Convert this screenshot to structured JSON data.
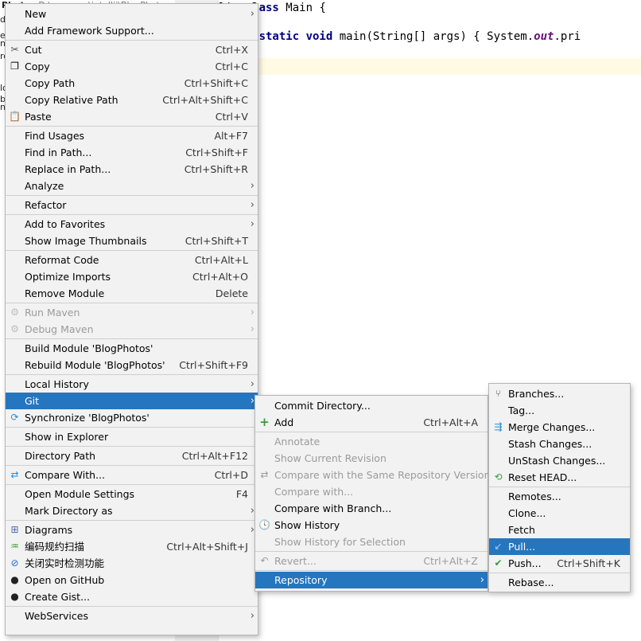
{
  "project_panel": {
    "title": "Photos",
    "path": "D:\\program\\intellij\\BlogPhotos",
    "tree_fragments": [
      "d",
      "e",
      "n",
      "ro",
      "",
      "lo",
      "b",
      "n"
    ]
  },
  "editor": {
    "line1_prefix": "lic ",
    "line1_kw": "class",
    "line1_rest": " Main {",
    "line2_kw": "ublic static void",
    "line2_rest": " main(String[] args) { System.",
    "line2_field": "out",
    "line2_tail": ".pri"
  },
  "context_menu": [
    {
      "label": "New",
      "arrow": true
    },
    {
      "label": "Add Framework Support..."
    },
    {
      "sep": true
    },
    {
      "label": "Cut",
      "shortcut": "Ctrl+X",
      "icon": "✂",
      "icon_name": "cut-icon"
    },
    {
      "label": "Copy",
      "shortcut": "Ctrl+C",
      "icon": "❐",
      "icon_name": "copy-icon"
    },
    {
      "label": "Copy Path",
      "shortcut": "Ctrl+Shift+C"
    },
    {
      "label": "Copy Relative Path",
      "shortcut": "Ctrl+Alt+Shift+C"
    },
    {
      "label": "Paste",
      "shortcut": "Ctrl+V",
      "icon": "📋",
      "icon_name": "paste-icon"
    },
    {
      "sep": true
    },
    {
      "label": "Find Usages",
      "shortcut": "Alt+F7"
    },
    {
      "label": "Find in Path...",
      "shortcut": "Ctrl+Shift+F"
    },
    {
      "label": "Replace in Path...",
      "shortcut": "Ctrl+Shift+R"
    },
    {
      "label": "Analyze",
      "arrow": true
    },
    {
      "sep": true
    },
    {
      "label": "Refactor",
      "arrow": true
    },
    {
      "sep": true
    },
    {
      "label": "Add to Favorites",
      "arrow": true
    },
    {
      "label": "Show Image Thumbnails",
      "shortcut": "Ctrl+Shift+T"
    },
    {
      "sep": true
    },
    {
      "label": "Reformat Code",
      "shortcut": "Ctrl+Alt+L"
    },
    {
      "label": "Optimize Imports",
      "shortcut": "Ctrl+Alt+O"
    },
    {
      "label": "Remove Module",
      "shortcut": "Delete"
    },
    {
      "sep": true
    },
    {
      "label": "Run Maven",
      "arrow": true,
      "disabled": true,
      "icon": "⚙",
      "icon_name": "maven-gear-icon"
    },
    {
      "label": "Debug Maven",
      "arrow": true,
      "disabled": true,
      "icon": "⚙",
      "icon_name": "maven-debug-icon"
    },
    {
      "sep": true
    },
    {
      "label": "Build Module 'BlogPhotos'"
    },
    {
      "label": "Rebuild Module 'BlogPhotos'",
      "shortcut": "Ctrl+Shift+F9"
    },
    {
      "sep": true
    },
    {
      "label": "Local History",
      "arrow": true
    },
    {
      "label": "Git",
      "arrow": true,
      "selected": true
    },
    {
      "label": "Synchronize 'BlogPhotos'",
      "icon": "⟳",
      "icon_name": "synchronize-icon"
    },
    {
      "sep": true
    },
    {
      "label": "Show in Explorer"
    },
    {
      "sep": true
    },
    {
      "label": "Directory Path",
      "shortcut": "Ctrl+Alt+F12"
    },
    {
      "sep": true
    },
    {
      "label": "Compare With...",
      "shortcut": "Ctrl+D",
      "icon": "⇄",
      "icon_name": "compare-icon"
    },
    {
      "sep": true
    },
    {
      "label": "Open Module Settings",
      "shortcut": "F4"
    },
    {
      "label": "Mark Directory as",
      "arrow": true
    },
    {
      "sep": true
    },
    {
      "label": "Diagrams",
      "arrow": true,
      "icon": "⊞",
      "icon_name": "diagrams-icon"
    },
    {
      "label": "编码规约扫描",
      "shortcut": "Ctrl+Alt+Shift+J",
      "icon": "♒",
      "icon_name": "code-scan-icon"
    },
    {
      "label": "关闭实时检测功能",
      "icon": "⊘",
      "icon_name": "disable-detection-icon"
    },
    {
      "label": "Open on GitHub",
      "icon": "●",
      "icon_name": "github-icon"
    },
    {
      "label": "Create Gist...",
      "icon": "●",
      "icon_name": "gist-icon"
    },
    {
      "sep": true
    },
    {
      "label": "WebServices",
      "arrow": true
    }
  ],
  "git_menu": [
    {
      "label": "Commit Directory..."
    },
    {
      "label": "Add",
      "shortcut": "Ctrl+Alt+A",
      "icon": "+",
      "icon_name": "add-icon"
    },
    {
      "sep": true
    },
    {
      "label": "Annotate",
      "disabled": true
    },
    {
      "label": "Show Current Revision",
      "disabled": true
    },
    {
      "label": "Compare with the Same Repository Version",
      "disabled": true,
      "icon": "⇄",
      "icon_name": "compare-same-icon"
    },
    {
      "label": "Compare with...",
      "disabled": true
    },
    {
      "label": "Compare with Branch..."
    },
    {
      "label": "Show History",
      "icon": "🕓",
      "icon_name": "history-icon"
    },
    {
      "label": "Show History for Selection",
      "disabled": true
    },
    {
      "sep": true
    },
    {
      "label": "Revert...",
      "shortcut": "Ctrl+Alt+Z",
      "disabled": true,
      "icon": "↶",
      "icon_name": "revert-icon"
    },
    {
      "sep": true
    },
    {
      "label": "Repository",
      "arrow": true,
      "selected": true
    }
  ],
  "repository_menu": [
    {
      "label": "Branches...",
      "icon": "⑂",
      "icon_name": "branches-icon"
    },
    {
      "label": "Tag..."
    },
    {
      "label": "Merge Changes...",
      "icon": "⇶",
      "icon_name": "merge-icon"
    },
    {
      "label": "Stash Changes..."
    },
    {
      "label": "UnStash Changes..."
    },
    {
      "label": "Reset HEAD...",
      "icon": "⟲",
      "icon_name": "reset-head-icon"
    },
    {
      "sep": true
    },
    {
      "label": "Remotes..."
    },
    {
      "label": "Clone..."
    },
    {
      "label": "Fetch"
    },
    {
      "label": "Pull...",
      "selected": true,
      "icon": "↙",
      "icon_name": "pull-icon"
    },
    {
      "label": "Push...",
      "shortcut": "Ctrl+Shift+K",
      "icon": "✔",
      "icon_name": "push-icon"
    },
    {
      "sep": true
    },
    {
      "label": "Rebase..."
    }
  ]
}
